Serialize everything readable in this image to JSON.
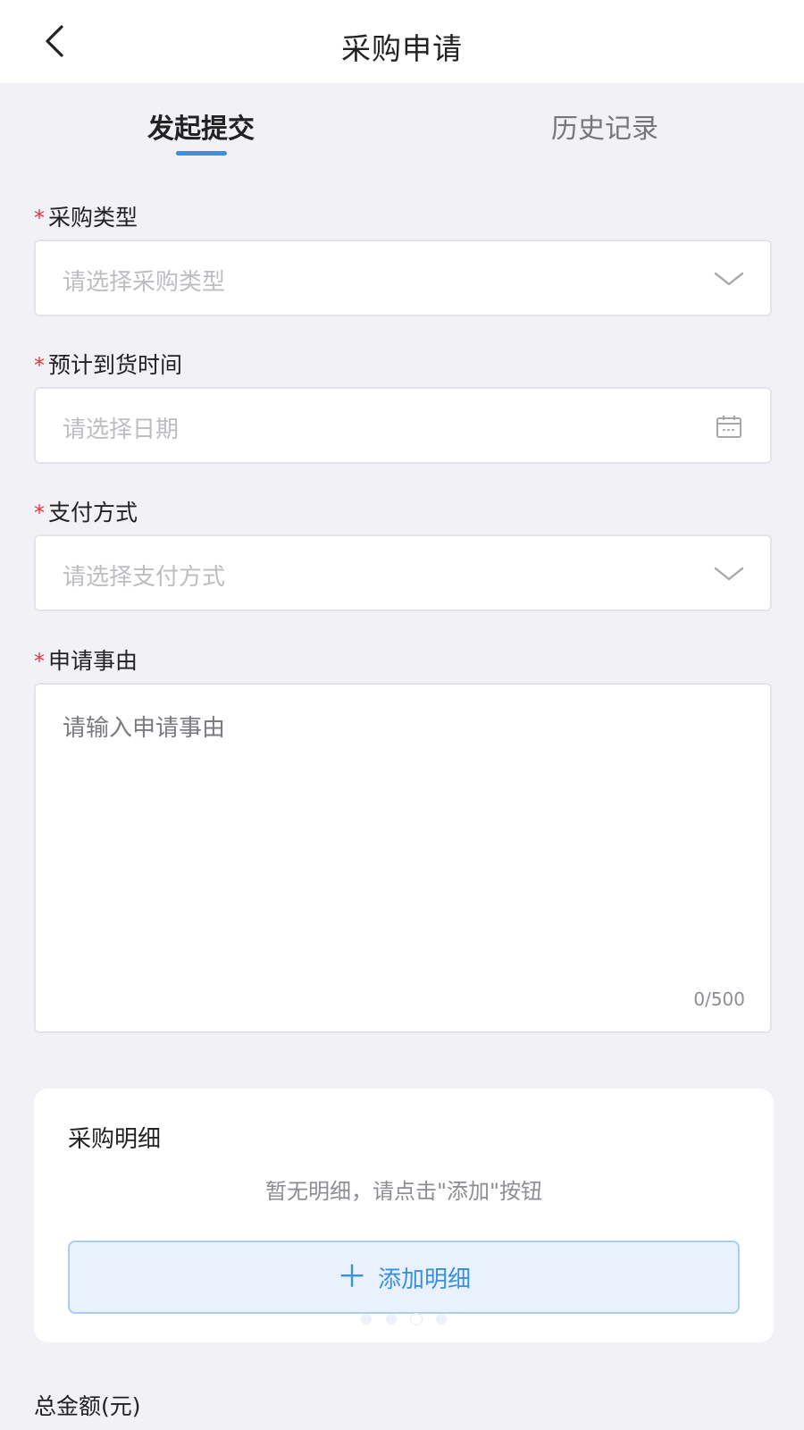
{
  "header": {
    "title": "采购申请"
  },
  "tabs": [
    {
      "label": "发起提交",
      "active": true
    },
    {
      "label": "历史记录",
      "active": false
    }
  ],
  "form": {
    "required_mark": "*",
    "purchase_type": {
      "label": "采购类型",
      "placeholder": "请选择采购类型",
      "icon": "chevron-down-icon"
    },
    "arrival_time": {
      "label": "预计到货时间",
      "placeholder": "请选择日期",
      "icon": "calendar-icon"
    },
    "payment_method": {
      "label": "支付方式",
      "placeholder": "请选择支付方式",
      "icon": "chevron-down-icon"
    },
    "reason": {
      "label": "申请事由",
      "placeholder": "请输入申请事由",
      "counter": "0/500"
    }
  },
  "details": {
    "title": "采购明细",
    "empty_hint": "暂无明细，请点击\"添加\"按钮",
    "add_button": "添加明细",
    "add_icon": "＋"
  },
  "total": {
    "label": "总金额(元)"
  },
  "colors": {
    "accent": "#3b8fe0",
    "required": "#e33b3b",
    "background": "#f1f1f6"
  }
}
